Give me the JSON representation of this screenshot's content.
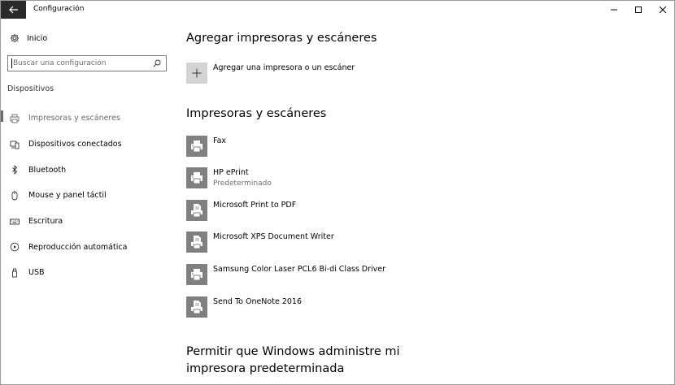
{
  "window": {
    "title": "Configuración",
    "icons": {
      "back": "back-arrow-icon",
      "minimize": "minimize-icon",
      "maximize": "maximize-icon",
      "close": "close-icon"
    }
  },
  "sidebar": {
    "home_label": "Inicio",
    "home_icon": "gear-icon",
    "search": {
      "placeholder": "Buscar una configuración",
      "value": ""
    },
    "section_label": "Dispositivos",
    "items": [
      {
        "label": "Impresoras y escáneres",
        "icon": "printer-icon",
        "active": true
      },
      {
        "label": "Dispositivos conectados",
        "icon": "devices-icon",
        "active": false
      },
      {
        "label": "Bluetooth",
        "icon": "bluetooth-icon",
        "active": false
      },
      {
        "label": "Mouse y panel táctil",
        "icon": "mouse-icon",
        "active": false
      },
      {
        "label": "Escritura",
        "icon": "keyboard-icon",
        "active": false
      },
      {
        "label": "Reproducción automática",
        "icon": "autoplay-icon",
        "active": false
      },
      {
        "label": "USB",
        "icon": "usb-icon",
        "active": false
      }
    ]
  },
  "main": {
    "add_heading": "Agregar impresoras y escáneres",
    "add_label": "Agregar una impresora o un escáner",
    "printers_heading": "Impresoras y escáneres",
    "printers": [
      {
        "name": "Fax",
        "sub": "",
        "icon": "printer-icon"
      },
      {
        "name": "HP ePrint",
        "sub": "Predeterminado",
        "icon": "printer-icon"
      },
      {
        "name": "Microsoft Print to PDF",
        "sub": "",
        "icon": "document-printer-icon"
      },
      {
        "name": "Microsoft XPS Document Writer",
        "sub": "",
        "icon": "document-printer-icon"
      },
      {
        "name": "Samsung Color Laser PCL6 Bi-di Class Driver",
        "sub": "",
        "icon": "printer-icon"
      },
      {
        "name": "Send To OneNote 2016",
        "sub": "",
        "icon": "document-printer-icon"
      }
    ],
    "permit_heading": "Permitir que Windows administre mi impresora predeterminada"
  },
  "colors": {
    "back_button_bg": "#2b2b2b",
    "printer_tile_bg": "#808080",
    "add_tile_bg": "#d3d3d3",
    "active_nav": "#6a6a6a"
  }
}
